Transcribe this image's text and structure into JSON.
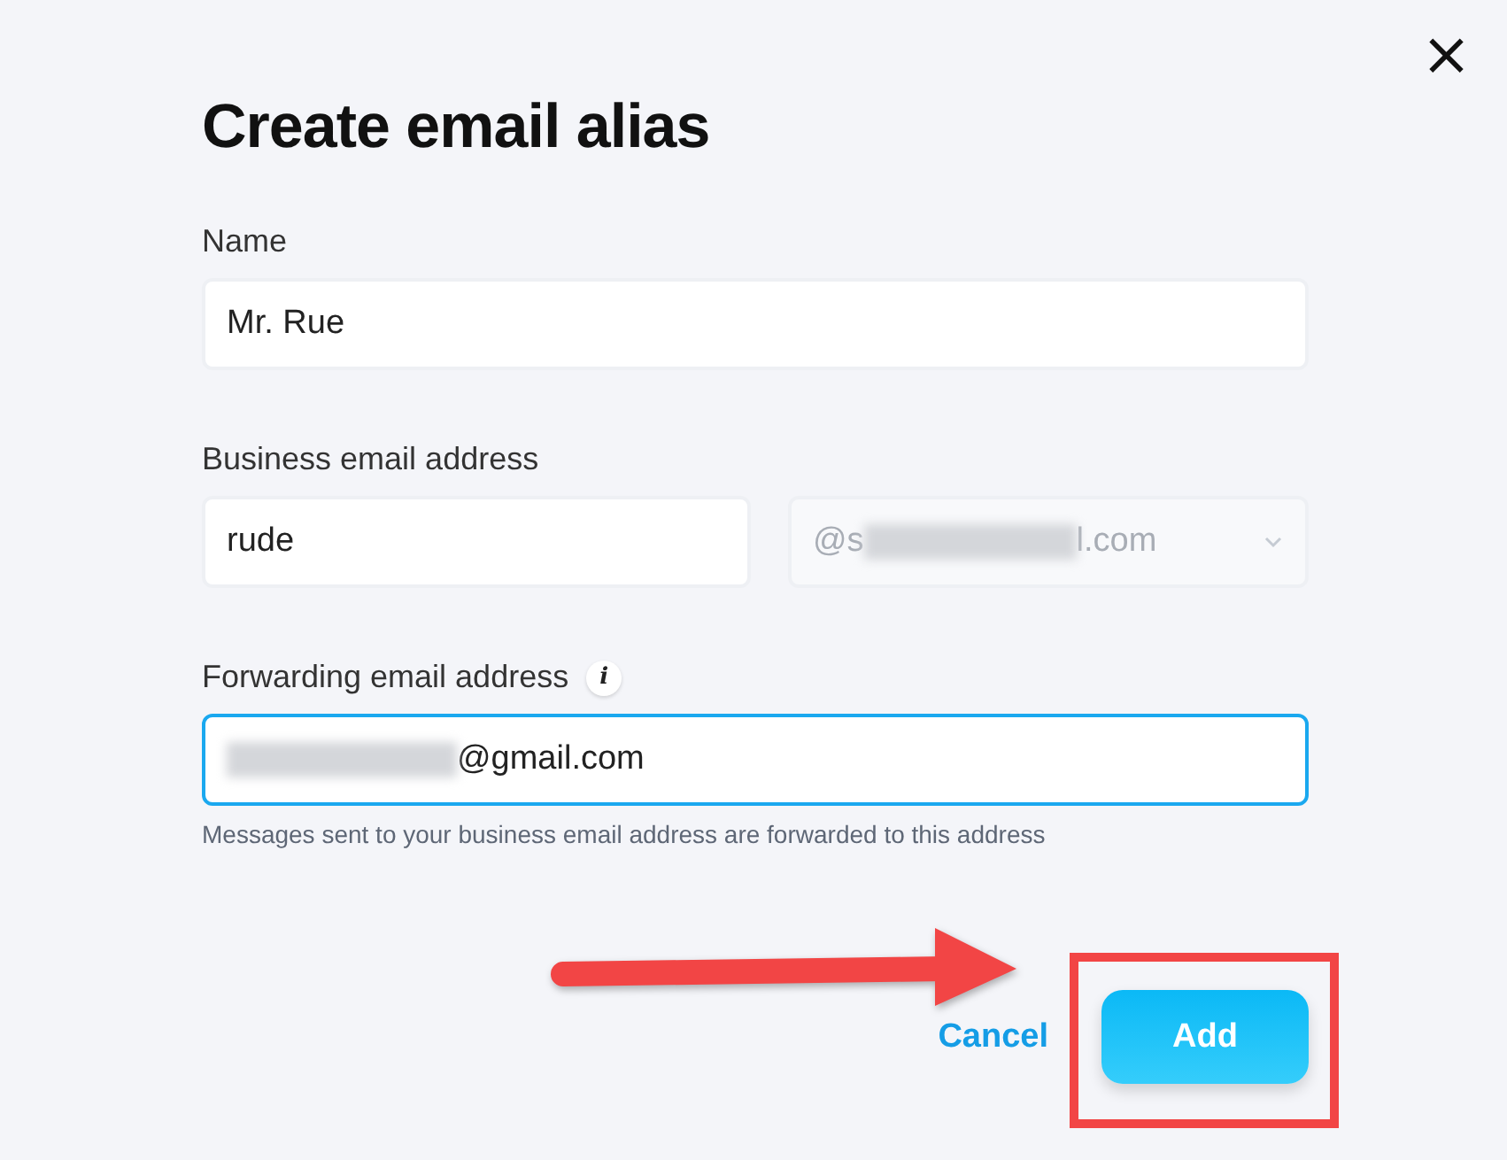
{
  "dialog": {
    "close_glyph": "×",
    "title": "Create email alias"
  },
  "fields": [
    {
      "kind": "text",
      "label": "Name",
      "value_parts": [
        {
          "kind": "text",
          "text": "Mr. Rue"
        }
      ],
      "focused": false
    },
    {
      "kind": "split",
      "label": "Business email address",
      "value_parts": [
        {
          "kind": "text",
          "text": "rude"
        }
      ],
      "focused": false,
      "domain_parts": [
        {
          "kind": "text",
          "text": "@s"
        },
        {
          "kind": "blur"
        },
        {
          "kind": "text",
          "text": "l.com"
        }
      ],
      "domain_disabled": true
    },
    {
      "kind": "text",
      "label": "Forwarding email address",
      "info_glyph": "i",
      "value_parts": [
        {
          "kind": "blur"
        },
        {
          "kind": "text",
          "text": "@gmail.com"
        }
      ],
      "focused": true,
      "hint": "Messages sent to your business email address are forwarded to this address"
    }
  ],
  "buttons": [
    {
      "kind": "link",
      "label": "Cancel"
    },
    {
      "kind": "primary",
      "label": "Add"
    }
  ],
  "annotations": {
    "arrow": true,
    "highlight_box": true
  }
}
